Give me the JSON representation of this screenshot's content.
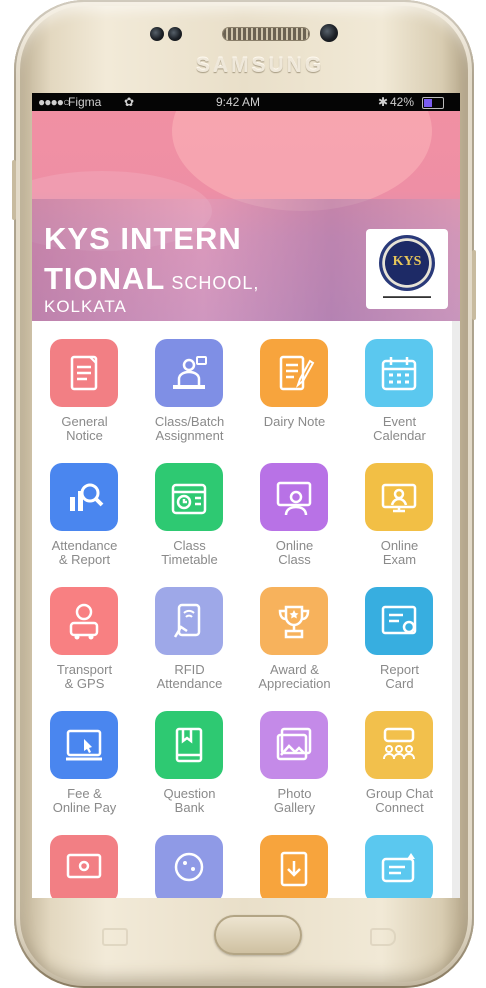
{
  "device": {
    "brand": "SAMSUNG"
  },
  "statusbar": {
    "dots": "●●●●○",
    "carrier": "Figma",
    "wifi": "✿",
    "time": "9:42 AM",
    "bluetooth": "✱",
    "battery": "42%"
  },
  "header": {
    "line1": "KYS INTERN",
    "line2": "TIONAL",
    "line2_small": "SCHOOL,",
    "line3": "KOLKATA",
    "logo_text": "KYS"
  },
  "colors": {
    "banner_pink": "#f190a3",
    "tile_red": "#f27f84",
    "tile_indigo": "#8090e6",
    "tile_orange": "#f7a43d",
    "tile_sky": "#5bc8ef",
    "tile_blue": "#4a86ef",
    "tile_green": "#2ec972",
    "tile_purple": "#b872e6",
    "tile_gold": "#f2bf45",
    "tile_salmon": "#f88082",
    "tile_lilac": "#9ea8e8",
    "tile_peach": "#f7b25c",
    "tile_teal": "#37aee0",
    "tile_mauve": "#c48ae8",
    "tile_amber": "#f2c04c"
  },
  "menu": [
    {
      "label": "General\nNotice",
      "icon": "notice-icon",
      "color": "#f27f84"
    },
    {
      "label": "Class/Batch\nAssignment",
      "icon": "teacher-icon",
      "color": "#7f8fe5"
    },
    {
      "label": "Dairy Note",
      "icon": "diary-icon",
      "color": "#f7a43d"
    },
    {
      "label": "Event\nCalendar",
      "icon": "calendar-icon",
      "color": "#5bc8ef"
    },
    {
      "label": "Attendance\n& Report",
      "icon": "report-icon",
      "color": "#4a86ef"
    },
    {
      "label": "Class\nTimetable",
      "icon": "timetable-icon",
      "color": "#2ec972"
    },
    {
      "label": "Online\nClass",
      "icon": "online-class-icon",
      "color": "#b872e6"
    },
    {
      "label": "Online\nExam",
      "icon": "online-exam-icon",
      "color": "#f2bf45"
    },
    {
      "label": "Transport\n& GPS",
      "icon": "bus-icon",
      "color": "#f88082"
    },
    {
      "label": "RFID\nAttendance",
      "icon": "rfid-icon",
      "color": "#9ea8e8"
    },
    {
      "label": "Award &\nAppreciation",
      "icon": "trophy-icon",
      "color": "#f7b25c"
    },
    {
      "label": "Report\nCard",
      "icon": "certificate-icon",
      "color": "#37aee0"
    },
    {
      "label": "Fee &\nOnline Pay",
      "icon": "payment-icon",
      "color": "#4a86ef"
    },
    {
      "label": "Question\nBank",
      "icon": "book-icon",
      "color": "#2ec972"
    },
    {
      "label": "Photo\nGallery",
      "icon": "gallery-icon",
      "color": "#c48ae8"
    },
    {
      "label": "Group Chat\nConnect",
      "icon": "chat-icon",
      "color": "#f2c04c"
    },
    {
      "label": "",
      "icon": "monitor-icon",
      "color": "#f27f84"
    },
    {
      "label": "",
      "icon": "globe-icon",
      "color": "#8f9ae6"
    },
    {
      "label": "",
      "icon": "download-icon",
      "color": "#f7a43d"
    },
    {
      "label": "",
      "icon": "notification-icon",
      "color": "#5bc8ef"
    }
  ]
}
